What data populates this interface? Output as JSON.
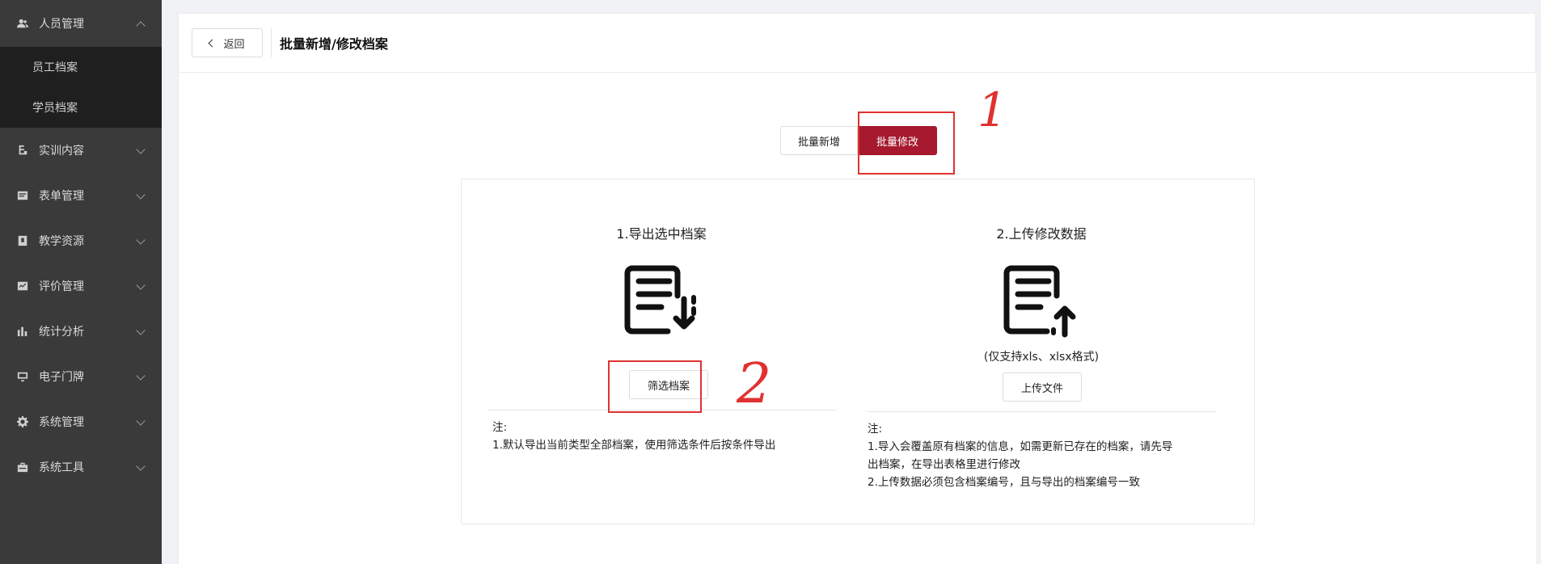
{
  "sidebar": {
    "groups": [
      {
        "label": "人员管理",
        "icon": "user-group-icon",
        "expanded": true,
        "items": [
          {
            "label": "员工档案"
          },
          {
            "label": "学员档案"
          }
        ]
      },
      {
        "label": "实训内容",
        "icon": "training-icon"
      },
      {
        "label": "表单管理",
        "icon": "form-icon"
      },
      {
        "label": "教学资源",
        "icon": "resource-icon"
      },
      {
        "label": "评价管理",
        "icon": "evaluation-icon"
      },
      {
        "label": "统计分析",
        "icon": "bar-chart-icon"
      },
      {
        "label": "电子门牌",
        "icon": "monitor-icon"
      },
      {
        "label": "系统管理",
        "icon": "gear-icon"
      },
      {
        "label": "系统工具",
        "icon": "toolbox-icon"
      }
    ]
  },
  "header": {
    "back_label": "返回",
    "title": "批量新增/修改档案"
  },
  "tabs": [
    {
      "label": "批量新增",
      "active": false
    },
    {
      "label": "批量修改",
      "active": true
    }
  ],
  "export_panel": {
    "title": "1.导出选中档案",
    "icon": "document-download-icon",
    "button_label": "筛选档案",
    "notes_title": "注:",
    "notes": [
      "1.默认导出当前类型全部档案，使用筛选条件后按条件导出"
    ]
  },
  "upload_panel": {
    "title": "2.上传修改数据",
    "icon": "document-upload-icon",
    "hint": "(仅支持xls、xlsx格式)",
    "button_label": "上传文件",
    "notes_title": "注:",
    "notes": [
      "1.导入会覆盖原有档案的信息，如需更新已存在的档案，请先导",
      "出档案，在导出表格里进行修改",
      "2.上传数据必须包含档案编号，且与导出的档案编号一致"
    ]
  },
  "annotations": {
    "mark_1": "1",
    "mark_2": "2",
    "color": "#e03131"
  },
  "colors": {
    "accent": "#a6192e",
    "sidebar_bg": "#3a3a3a",
    "submenu_bg": "#1f1f1f"
  }
}
